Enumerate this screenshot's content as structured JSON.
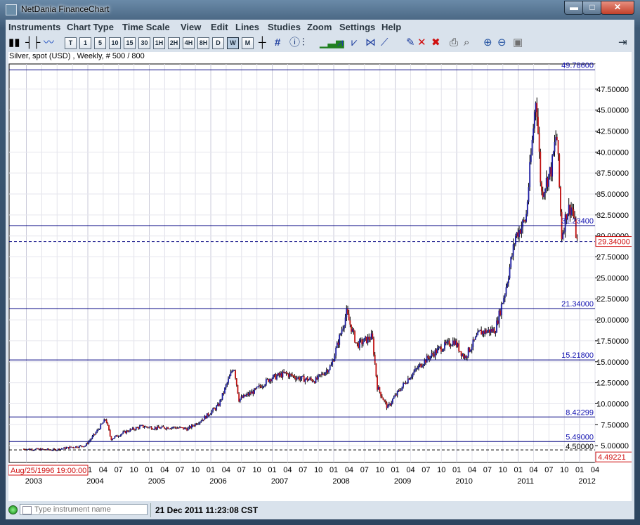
{
  "window": {
    "title": "NetDania FinanceChart",
    "min_glyph": "▬",
    "max_glyph": "□",
    "close_glyph": "✕"
  },
  "menu": [
    {
      "label": "Instruments"
    },
    {
      "label": "Chart Type"
    },
    {
      "label": "Time Scale"
    },
    {
      "label": "View"
    },
    {
      "label": "Edit"
    },
    {
      "label": "Lines"
    },
    {
      "label": "Studies"
    },
    {
      "label": "Zoom"
    },
    {
      "label": "Settings"
    },
    {
      "label": "Help"
    }
  ],
  "toolbar": {
    "intervals": [
      "T",
      "1",
      "5",
      "10",
      "15",
      "30",
      "1H",
      "2H",
      "4H",
      "8H",
      "D",
      "W",
      "M"
    ],
    "selected_interval": "W"
  },
  "chart": {
    "header": "Silver, spot (USD) , Weekly, # 500 / 800",
    "date_box": "Aug/25/1996 19:00:00",
    "accent_color": "#1010b0",
    "line_color": "#000080",
    "last_color": "#d01010"
  },
  "chart_data": {
    "type": "candlestick",
    "instrument": "Silver, spot (USD)",
    "interval": "Weekly",
    "ylim": [
      3.0,
      50.5
    ],
    "yticks": [
      5.0,
      7.5,
      10.0,
      12.5,
      15.0,
      17.5,
      20.0,
      22.5,
      25.0,
      27.5,
      30.0,
      32.5,
      35.0,
      37.5,
      40.0,
      42.5,
      45.0,
      47.5
    ],
    "ytick_labels": [
      "5.00000",
      "7.50000",
      "10.00000",
      "12.50000",
      "15.00000",
      "17.50000",
      "20.00000",
      "22.50000",
      "25.00000",
      "27.50000",
      "30.00000",
      "32.50000",
      "35.00000",
      "37.50000",
      "40.00000",
      "42.50000",
      "45.00000",
      "47.50000"
    ],
    "year_labels": [
      "2003",
      "2004",
      "2005",
      "2006",
      "2007",
      "2008",
      "2009",
      "2010",
      "2011",
      "2012"
    ],
    "month_labels": [
      "01",
      "04",
      "07",
      "10"
    ],
    "horizontal_lines": [
      {
        "value": 49.786,
        "label": "49.78600"
      },
      {
        "value": 31.234,
        "label": "31.23400"
      },
      {
        "value": 21.34,
        "label": "21.34000"
      },
      {
        "value": 15.218,
        "label": "15.21800"
      },
      {
        "value": 8.42299,
        "label": "8.42299"
      },
      {
        "value": 5.49,
        "label": "5.49000"
      }
    ],
    "dashed_lines": [
      {
        "value": 29.34,
        "label": "29.34000",
        "style": "last price"
      },
      {
        "value": 4.5,
        "label": "4.50000",
        "style": "reference"
      }
    ],
    "low_marker": {
      "value": 4.49221,
      "label": "4.49221"
    },
    "price_path": [
      [
        "2002-12",
        4.6
      ],
      [
        "2003-03",
        4.55
      ],
      [
        "2003-06",
        4.5
      ],
      [
        "2003-09",
        4.8
      ],
      [
        "2003-12",
        5.0
      ],
      [
        "2004-02",
        6.5
      ],
      [
        "2004-04",
        8.2
      ],
      [
        "2004-05",
        5.8
      ],
      [
        "2004-08",
        6.7
      ],
      [
        "2004-11",
        7.3
      ],
      [
        "2005-02",
        7.1
      ],
      [
        "2005-05",
        7.2
      ],
      [
        "2005-08",
        7.0
      ],
      [
        "2005-11",
        8.2
      ],
      [
        "2006-02",
        9.8
      ],
      [
        "2006-05",
        14.5
      ],
      [
        "2006-06",
        10.5
      ],
      [
        "2006-09",
        11.5
      ],
      [
        "2006-12",
        13.0
      ],
      [
        "2007-03",
        13.6
      ],
      [
        "2007-06",
        13.0
      ],
      [
        "2007-09",
        12.8
      ],
      [
        "2007-12",
        14.5
      ],
      [
        "2008-03",
        20.8
      ],
      [
        "2008-05",
        17.0
      ],
      [
        "2008-08",
        18.0
      ],
      [
        "2008-09",
        12.0
      ],
      [
        "2008-11",
        9.5
      ],
      [
        "2008-12",
        10.5
      ],
      [
        "2009-03",
        13.0
      ],
      [
        "2009-06",
        15.0
      ],
      [
        "2009-09",
        16.5
      ],
      [
        "2009-12",
        17.5
      ],
      [
        "2010-02",
        15.5
      ],
      [
        "2010-05",
        18.5
      ],
      [
        "2010-08",
        18.8
      ],
      [
        "2010-10",
        23.5
      ],
      [
        "2010-12",
        30.0
      ],
      [
        "2011-02",
        32.0
      ],
      [
        "2011-04",
        47.0
      ],
      [
        "2011-05",
        35.0
      ],
      [
        "2011-07",
        38.0
      ],
      [
        "2011-08",
        42.5
      ],
      [
        "2011-09",
        30.0
      ],
      [
        "2011-10",
        33.0
      ],
      [
        "2011-11",
        33.5
      ],
      [
        "2011-12",
        29.34
      ]
    ]
  },
  "status": {
    "input_placeholder": "Type instrument name",
    "datetime": "21 Dec 2011 11:23:08 CST"
  }
}
